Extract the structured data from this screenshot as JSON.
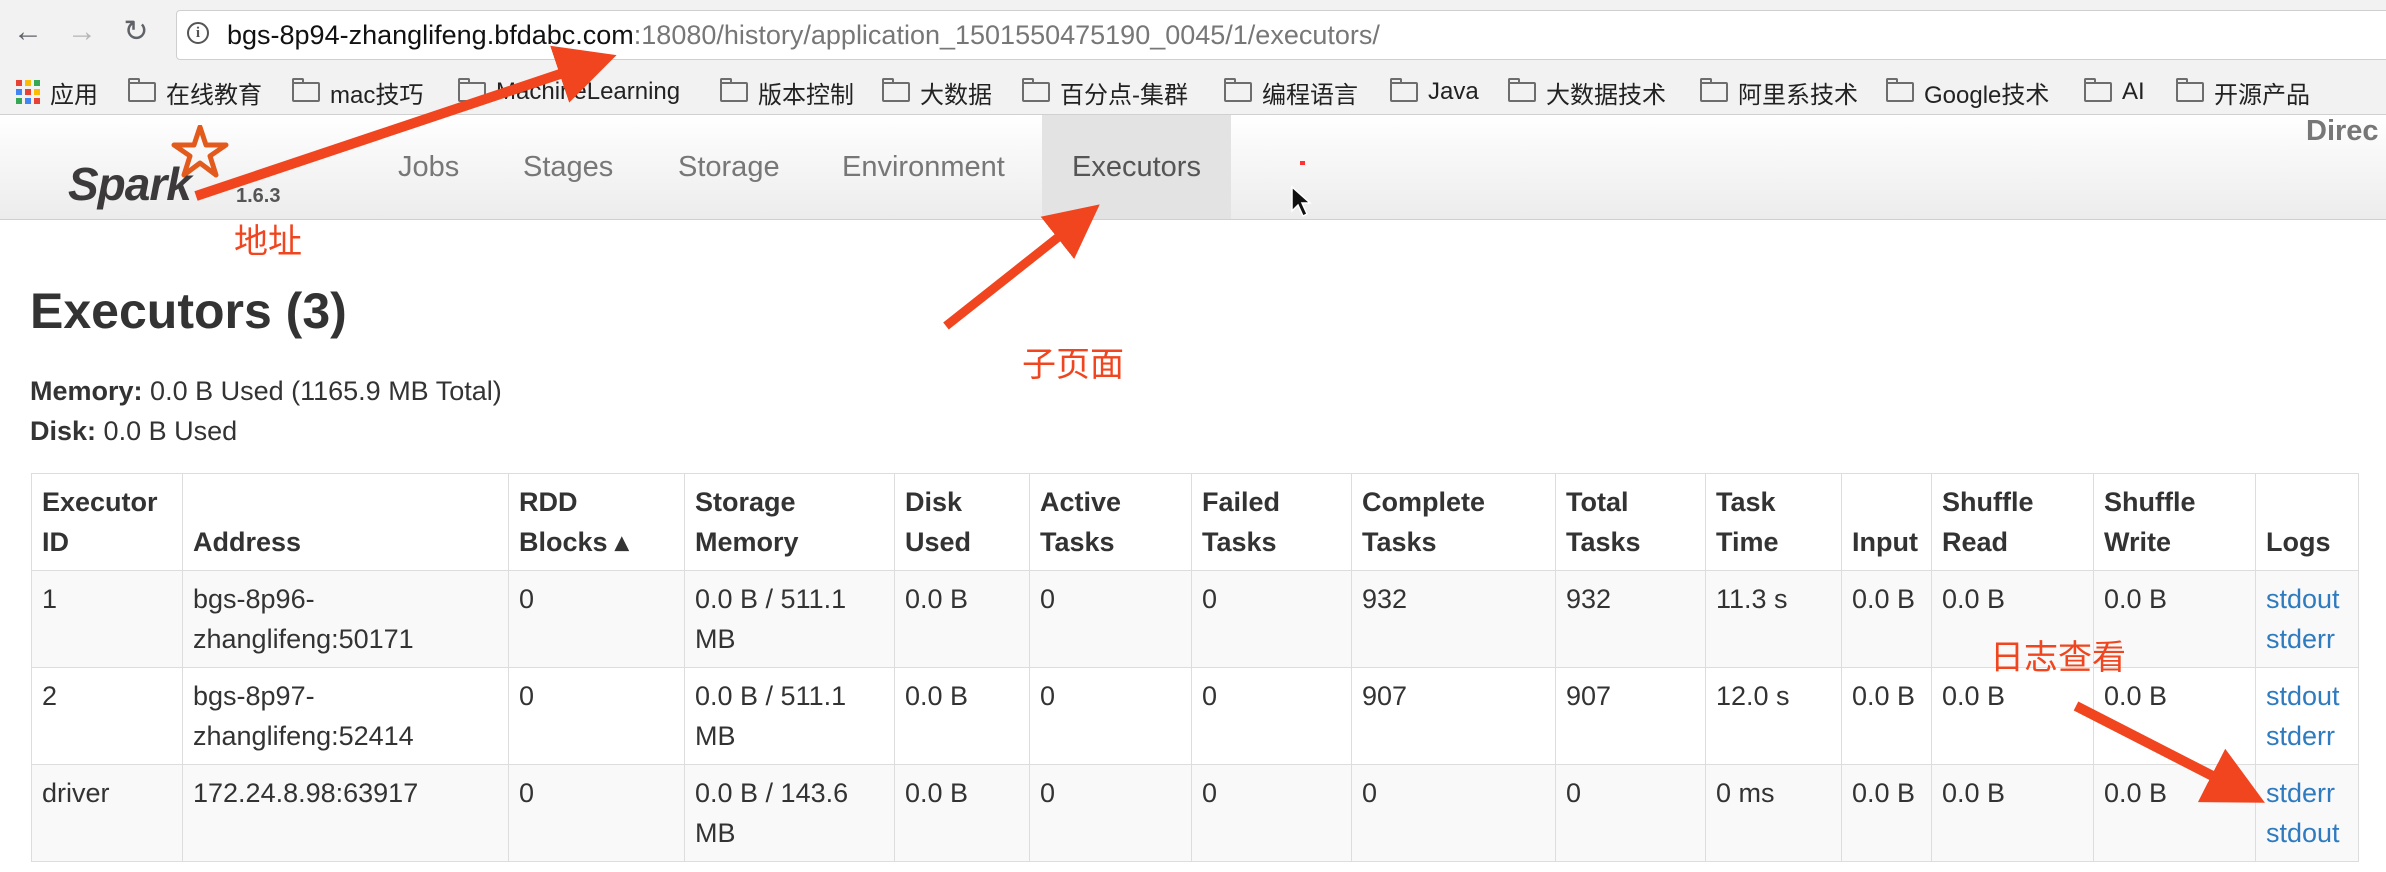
{
  "browser": {
    "back_glyph": "←",
    "forward_glyph": "→",
    "reload_glyph": "↻",
    "info_glyph": "i",
    "url_host": "bgs-8p94-zhanglifeng.bfdabc.com",
    "url_rest": ":18080/history/application_1501550475190_0045/1/executors/",
    "bookmarks": [
      {
        "label": "应用",
        "icon": "apps-grid-icon"
      },
      {
        "label": "在线教育",
        "icon": "folder-icon"
      },
      {
        "label": "mac技巧",
        "icon": "folder-icon"
      },
      {
        "label": "MachineLearning",
        "icon": "folder-icon"
      },
      {
        "label": "版本控制",
        "icon": "folder-icon"
      },
      {
        "label": "大数据",
        "icon": "folder-icon"
      },
      {
        "label": "百分点-集群",
        "icon": "folder-icon"
      },
      {
        "label": "编程语言",
        "icon": "folder-icon"
      },
      {
        "label": "Java",
        "icon": "folder-icon"
      },
      {
        "label": "大数据技术",
        "icon": "folder-icon"
      },
      {
        "label": "阿里系技术",
        "icon": "folder-icon"
      },
      {
        "label": "Google技术",
        "icon": "folder-icon"
      },
      {
        "label": "AI",
        "icon": "folder-icon"
      },
      {
        "label": "开源产品",
        "icon": "folder-icon"
      }
    ]
  },
  "navbar": {
    "logo_text": "Spark",
    "version": "1.6.3",
    "tabs": [
      "Jobs",
      "Stages",
      "Storage",
      "Environment",
      "Executors"
    ],
    "active_tab": "Executors",
    "right_text": "Direc"
  },
  "page": {
    "title": "Executors (3)",
    "memory_label": "Memory:",
    "memory_value": "0.0 B Used (1165.9 MB Total)",
    "disk_label": "Disk:",
    "disk_value": "0.0 B Used"
  },
  "table": {
    "headers": [
      [
        "Executor",
        "ID"
      ],
      [
        "Address"
      ],
      [
        "RDD",
        "Blocks ▴"
      ],
      [
        "Storage",
        "Memory"
      ],
      [
        "Disk",
        "Used"
      ],
      [
        "Active",
        "Tasks"
      ],
      [
        "Failed",
        "Tasks"
      ],
      [
        "Complete",
        "Tasks"
      ],
      [
        "Total",
        "Tasks"
      ],
      [
        "Task",
        "Time"
      ],
      [
        "Input"
      ],
      [
        "Shuffle",
        "Read"
      ],
      [
        "Shuffle",
        "Write"
      ],
      [
        "Logs"
      ]
    ],
    "rows": [
      {
        "id": "1",
        "address": [
          "bgs-8p96-",
          "zhanglifeng:50171"
        ],
        "rdd_blocks": "0",
        "storage_memory": [
          "0.0 B / 511.1",
          "MB"
        ],
        "disk_used": "0.0 B",
        "active_tasks": "0",
        "failed_tasks": "0",
        "complete_tasks": "932",
        "total_tasks": "932",
        "task_time": "11.3 s",
        "input": "0.0 B",
        "shuffle_read": "0.0 B",
        "shuffle_write": "0.0 B",
        "logs": [
          "stdout",
          "stderr"
        ]
      },
      {
        "id": "2",
        "address": [
          "bgs-8p97-",
          "zhanglifeng:52414"
        ],
        "rdd_blocks": "0",
        "storage_memory": [
          "0.0 B / 511.1",
          "MB"
        ],
        "disk_used": "0.0 B",
        "active_tasks": "0",
        "failed_tasks": "0",
        "complete_tasks": "907",
        "total_tasks": "907",
        "task_time": "12.0 s",
        "input": "0.0 B",
        "shuffle_read": "0.0 B",
        "shuffle_write": "0.0 B",
        "logs": [
          "stdout",
          "stderr"
        ]
      },
      {
        "id": "driver",
        "address": [
          "172.24.8.98:63917"
        ],
        "rdd_blocks": "0",
        "storage_memory": [
          "0.0 B / 143.6",
          "MB"
        ],
        "disk_used": "0.0 B",
        "active_tasks": "0",
        "failed_tasks": "0",
        "complete_tasks": "0",
        "total_tasks": "0",
        "task_time": "0 ms",
        "input": "0.0 B",
        "shuffle_read": "0.0 B",
        "shuffle_write": "0.0 B",
        "logs": [
          "stderr",
          "stdout"
        ]
      }
    ]
  },
  "annotations": {
    "address": "地址",
    "subpage": "子页面",
    "logs": "日志查看",
    "color": "#f0451e"
  },
  "colors": {
    "link": "#2f7bbf",
    "active_tab_bg": "#e3e3e3",
    "spark_star": "#e25a1c"
  }
}
